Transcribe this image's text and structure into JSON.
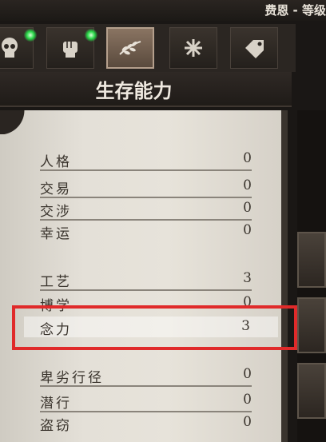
{
  "header": {
    "character_title": "费恩 - 等级"
  },
  "tabs": [
    {
      "icon": "skull-icon",
      "active": false
    },
    {
      "icon": "fist-icon",
      "active": false
    },
    {
      "icon": "laurel-icon",
      "active": true
    },
    {
      "icon": "snowflake-icon",
      "active": false
    },
    {
      "icon": "tag-icon",
      "active": false
    }
  ],
  "panel": {
    "title": "生存能力",
    "groups": [
      {
        "rows": [
          {
            "label": "人格",
            "value": "0"
          }
        ]
      },
      {
        "rows": [
          {
            "label": "交易",
            "value": "0"
          },
          {
            "label": "交涉",
            "value": "0"
          },
          {
            "label": "幸运",
            "value": "0"
          }
        ]
      },
      {
        "rows": [
          {
            "label": "工艺",
            "value": "3"
          },
          {
            "label": "博学",
            "value": "0"
          },
          {
            "label": "念力",
            "value": "3"
          }
        ]
      },
      {
        "rows": [
          {
            "label": "卑劣行径",
            "value": "0"
          },
          {
            "label": "潜行",
            "value": "0"
          },
          {
            "label": "盗窃",
            "value": "0"
          }
        ]
      }
    ]
  },
  "colors": {
    "highlight_box": "#e02a2a",
    "glow": "#28d848"
  }
}
